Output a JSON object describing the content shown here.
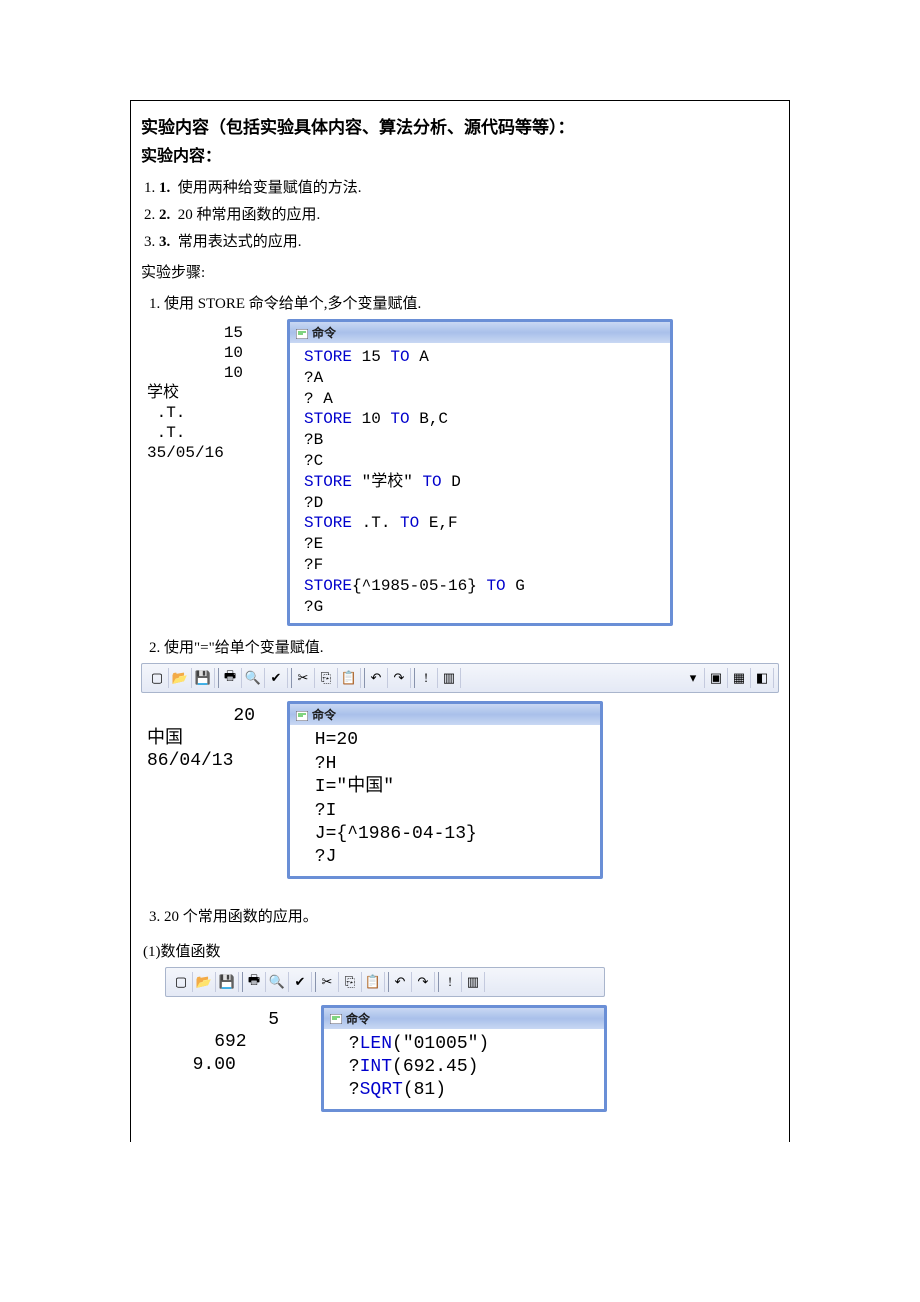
{
  "header": {
    "title": "实验内容（包括实验具体内容、算法分析、源代码等等）：",
    "subtitle": "实验内容："
  },
  "intro_list": [
    "使用两种给变量赋值的方法.",
    "20 种常用函数的应用.",
    "常用表达式的应用."
  ],
  "steps_label": "实验步骤:",
  "step1": {
    "label": "1.   使用 STORE 命令给单个,多个变量赋值.",
    "output": "        15\n        10\n        10\n学校\n .T.\n .T.\n35/05/16",
    "cmd_title": "命令",
    "code_lines": [
      {
        "t": "kw",
        "v": "STORE"
      },
      {
        "t": "p",
        "v": " 15 "
      },
      {
        "t": "kw",
        "v": "TO"
      },
      {
        "t": "p",
        "v": " A\n?A\n? A\n"
      },
      {
        "t": "kw",
        "v": "STORE"
      },
      {
        "t": "p",
        "v": " 10 "
      },
      {
        "t": "kw",
        "v": "TO"
      },
      {
        "t": "p",
        "v": " B,C\n?B\n?C\n"
      },
      {
        "t": "kw",
        "v": "STORE"
      },
      {
        "t": "p",
        "v": " \"学校\" "
      },
      {
        "t": "kw",
        "v": "TO"
      },
      {
        "t": "p",
        "v": " D\n?D\n"
      },
      {
        "t": "kw",
        "v": "STORE"
      },
      {
        "t": "p",
        "v": " .T. "
      },
      {
        "t": "kw",
        "v": "TO"
      },
      {
        "t": "p",
        "v": " E,F\n?E\n?F\n"
      },
      {
        "t": "kw",
        "v": "STORE"
      },
      {
        "t": "p",
        "v": "{^1985-05-16} "
      },
      {
        "t": "kw",
        "v": "TO"
      },
      {
        "t": "p",
        "v": " G\n?G"
      }
    ]
  },
  "step2": {
    "label": "2.   使用\"=\"给单个变量赋值.",
    "output": "        20\n中国\n86/04/13",
    "cmd_title": "命令",
    "code_lines": [
      {
        "t": "p",
        "v": " H=20\n ?H\n I=\"中国\"\n ?I\n J={^1986-04-13}\n ?J"
      }
    ]
  },
  "step3": {
    "label": "3.   20 个常用函数的应用。",
    "sub": "(1)数值函数",
    "output": "         5\n    692\n  9.00",
    "cmd_title": "命令",
    "code_lines": [
      {
        "t": "p",
        "v": " ?"
      },
      {
        "t": "kw",
        "v": "LEN"
      },
      {
        "t": "p",
        "v": "(\"01005\")\n ?"
      },
      {
        "t": "kw",
        "v": "INT"
      },
      {
        "t": "p",
        "v": "(692.45)\n ?"
      },
      {
        "t": "kw",
        "v": "SQRT"
      },
      {
        "t": "p",
        "v": "(81)"
      }
    ]
  },
  "toolbar_icons": [
    "new-icon",
    "open-icon",
    "save-icon",
    "print-icon",
    "preview-icon",
    "spell-icon",
    "cut-icon",
    "copy-icon",
    "paste-icon",
    "undo-icon",
    "redo-icon",
    "run-icon",
    "modify-icon"
  ],
  "toolbar_right": [
    "dropdown-icon",
    "window-icon",
    "form-icon",
    "help-icon"
  ],
  "chart_data": null
}
